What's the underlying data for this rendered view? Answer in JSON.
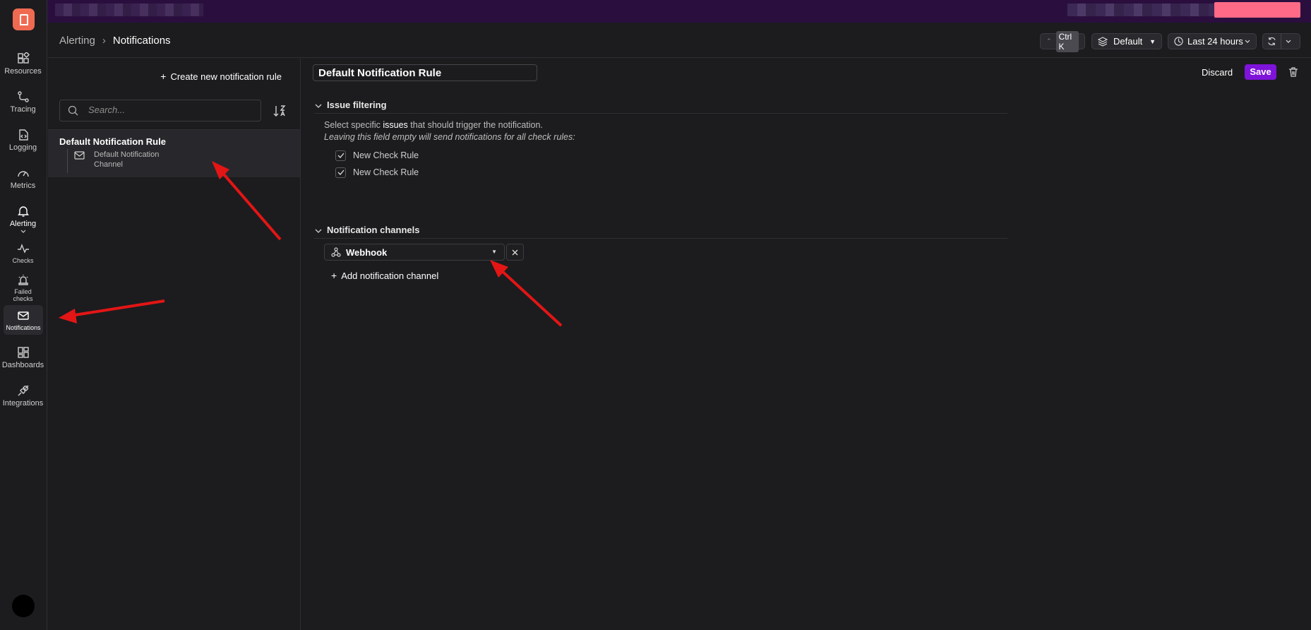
{
  "nav": {
    "items": [
      {
        "label": "Resources",
        "icon": "resources-icon"
      },
      {
        "label": "Tracing",
        "icon": "tracing-icon"
      },
      {
        "label": "Logging",
        "icon": "logging-icon"
      },
      {
        "label": "Metrics",
        "icon": "metrics-icon"
      },
      {
        "label": "Alerting",
        "icon": "bell-icon"
      },
      {
        "label": "Checks",
        "icon": "checks-icon"
      },
      {
        "label": "Failed checks",
        "icon": "siren-icon"
      },
      {
        "label": "Notifications",
        "icon": "mail-icon"
      },
      {
        "label": "Dashboards",
        "icon": "dashboards-icon"
      },
      {
        "label": "Integrations",
        "icon": "plug-icon"
      }
    ]
  },
  "header": {
    "breadcrumb_parent": "Alerting",
    "breadcrumb_current": "Notifications",
    "shortcut": "Ctrl K",
    "workspace": "Default",
    "time_range": "Last 24 hours"
  },
  "list": {
    "create_label": "Create new notification rule",
    "search_placeholder": "Search...",
    "rule_title": "Default Notification Rule",
    "rule_channel": "Default Notification Channel"
  },
  "editor": {
    "rule_name": "Default Notification Rule",
    "discard_label": "Discard",
    "save_label": "Save",
    "issue_filtering_title": "Issue filtering",
    "desc_prefix": "Select specific ",
    "desc_highlight": "issues",
    "desc_suffix": " that should trigger the notification.",
    "desc_italic": "Leaving this field empty will send notifications for all check rules:",
    "checks": [
      "New Check Rule",
      "New Check Rule"
    ],
    "channels_title": "Notification channels",
    "channel_selected": "Webhook",
    "add_channel_label": "Add notification channel"
  },
  "colors": {
    "accent": "#7e13d9",
    "logo": "#f06a52",
    "annotation_arrow": "#e31515"
  }
}
